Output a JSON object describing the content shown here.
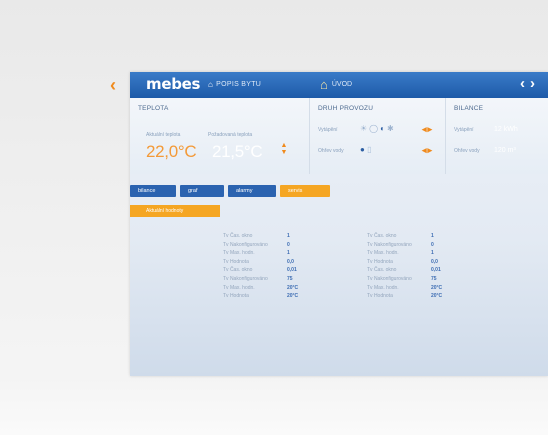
{
  "nav": {
    "back_glyph": "‹"
  },
  "topbar": {
    "logo": "mebes",
    "house_label": "POPIS BYTU",
    "house_icon": "building-icon",
    "home_label": "ÚVOD",
    "home_icon": "house-icon",
    "prev_glyph": "‹",
    "next_glyph": "›"
  },
  "teplota": {
    "title": "TEPLOTA",
    "measured_label": "Aktuální teplota",
    "setpoint_label": "Požadovaná teplota",
    "measured_value": "22,0°C",
    "setpoint_value": "21,5°C",
    "up_glyph": "▲",
    "down_glyph": "▼"
  },
  "druh": {
    "title": "DRUH PROVOZU",
    "heating_label": "Vytápění",
    "water_label": "Ohřev vody",
    "lr_glyphs": "◂▸"
  },
  "bilance": {
    "title": "BILANCE",
    "heating_label": "Vytápění",
    "water_label": "Ohřev vody",
    "heating_value": "12 kWh",
    "water_value": "120 m³"
  },
  "tabs": [
    {
      "label": "bilance",
      "active": false
    },
    {
      "label": "graf",
      "active": false
    },
    {
      "label": "alarmy",
      "active": false
    },
    {
      "label": "servis",
      "active": true
    }
  ],
  "subtab": {
    "label": "Aktuální hodnoty"
  },
  "params_left": [
    {
      "label": "Tv Čas. okno",
      "value": "1"
    },
    {
      "label": "Tv Nakonfigurováno",
      "value": "0"
    },
    {
      "label": "Tv Max. hodn.",
      "value": "1"
    },
    {
      "label": "Tv Hodnota",
      "value": "0,0"
    },
    {
      "label": "Tv Čas. okno",
      "value": "0,01"
    },
    {
      "label": "Tv Nakonfigurováno",
      "value": "75"
    },
    {
      "label": "Tv Max. hodn.",
      "value": "20°C"
    },
    {
      "label": "Tv Hodnota",
      "value": "20°C"
    }
  ],
  "params_right": [
    {
      "label": "Tv Čas. okno",
      "value": "1"
    },
    {
      "label": "Tv Nakonfigurováno",
      "value": "0"
    },
    {
      "label": "Tv Max. hodn.",
      "value": "1"
    },
    {
      "label": "Tv Hodnota",
      "value": "0,0"
    },
    {
      "label": "Tv Čas. okno",
      "value": "0,01"
    },
    {
      "label": "Tv Nakonfigurováno",
      "value": "75"
    },
    {
      "label": "Tv Max. hodn.",
      "value": "20°C"
    },
    {
      "label": "Tv Hodnota",
      "value": "20°C"
    }
  ],
  "colors": {
    "accent": "#f5a623",
    "brand_blue": "#2b63b0",
    "temp_orange": "#f39a38"
  }
}
